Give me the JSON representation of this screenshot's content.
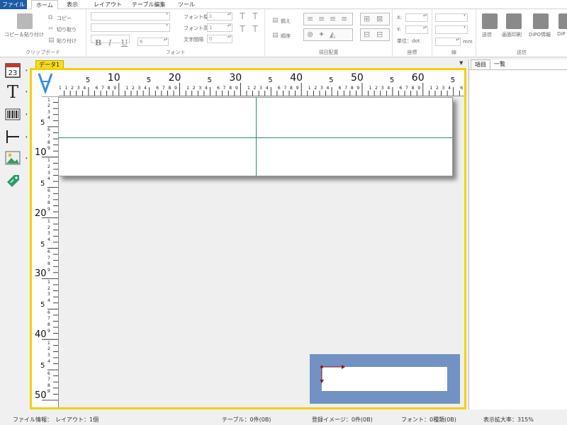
{
  "menu": {
    "file": "ファイル",
    "tabs": [
      "ホーム",
      "表示",
      "レイアウト",
      "テーブル編集",
      "ツール"
    ]
  },
  "ribbon": {
    "clipboard": {
      "paste": "コピー＆貼り付け",
      "copy": "コピー",
      "cut": "切り取り",
      "paste_small": "貼り付け",
      "label": "クリップボード"
    },
    "font": {
      "font_width": "フォント幅",
      "font_height": "フォント高",
      "char_spacing": "文字間隔",
      "width_value": "1",
      "height_value": "1",
      "spacing_value": "0",
      "size_value": "6",
      "bold": "B",
      "italic": "I",
      "underline": "U",
      "label": "フォント"
    },
    "item_layout": {
      "align": "揃え",
      "order": "順序",
      "label": "項目配置"
    },
    "coords": {
      "x": "X:",
      "y": "Y:",
      "unit": "単位：dot",
      "label": "座標"
    },
    "line": {
      "mm": "mm",
      "label": "線"
    },
    "send": {
      "items": [
        "送信",
        "画面印刷",
        "DiPO情報",
        "DiP"
      ],
      "label": "送信"
    }
  },
  "document": {
    "tab": "データ1"
  },
  "ruler": {
    "h_major": [
      "10",
      "20",
      "30",
      "40",
      "50",
      "60"
    ],
    "v_major": [
      "10",
      "20",
      "30",
      "40",
      "50"
    ],
    "mid": "5"
  },
  "right_panel": {
    "tabs": [
      "項目",
      "一覧"
    ]
  },
  "status": {
    "file_info": "ファイル情報：　レイアウト：1個",
    "table": "テーブル：0件(0B)",
    "images": "登録イメージ：0件(0B)",
    "fonts": "フォント：0種類(0B)",
    "zoom": "表示拡大率：315%"
  },
  "colors": {
    "accent": "#1e5aa8",
    "frame": "#f2d10a",
    "guide": "#2f8f6f",
    "minimap": "#7192c2"
  }
}
